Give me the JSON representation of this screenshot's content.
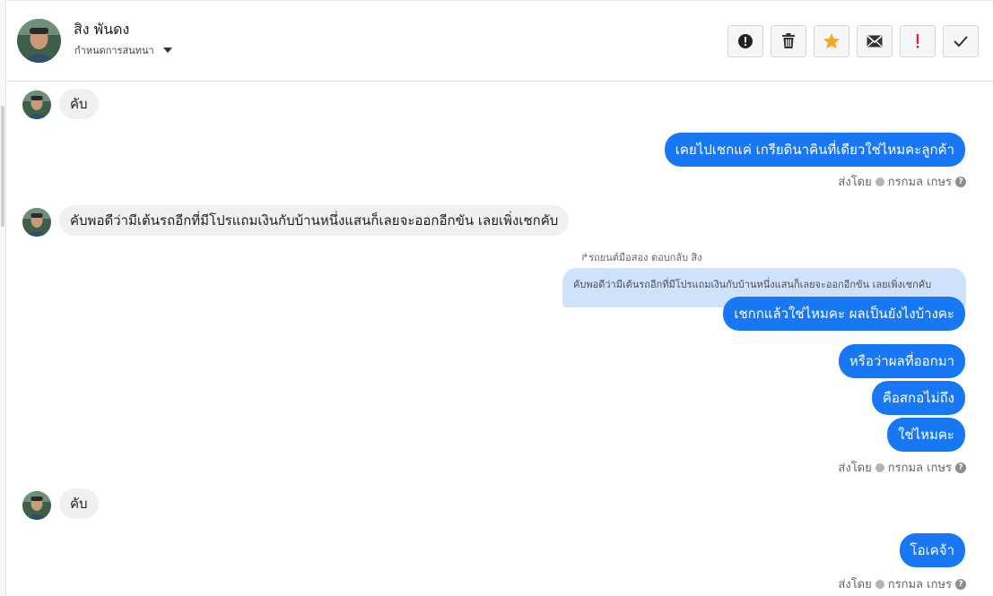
{
  "header": {
    "contact_name": "สิง พันดง",
    "assign_label": "กำหนดการสนทนา"
  },
  "actions": [
    {
      "name": "report-spam",
      "icon": "alert-circle-icon"
    },
    {
      "name": "delete",
      "icon": "trash-icon"
    },
    {
      "name": "star",
      "icon": "star-icon",
      "color": "#f5a623"
    },
    {
      "name": "mark-unread",
      "icon": "envelope-icon"
    },
    {
      "name": "follow-up",
      "icon": "exclamation-icon",
      "color": "#e41e3f"
    },
    {
      "name": "mark-done",
      "icon": "check-icon"
    }
  ],
  "colors": {
    "outgoing_bubble": "#1877f2",
    "incoming_bubble": "#f0f0f0",
    "quoted_bubble": "#cfe2fb"
  },
  "messages": {
    "in1": "คับ",
    "out1": "เคยไปเชกแค่ เกรียดินาคินที่เดียวใช่ไหมคะลูกค้า",
    "sent1": "ส่งโดย",
    "sender1": "กรกมล เกษร",
    "in2": "คับพอดีว่ามีเต้นรถอีกที่มีโปรแถมเงินกับบ้านหนึ่งแสนก็เลยจะออกอีกขัน เลยเพิ่งเชกคับ",
    "reply_note": "รถยนต์มือสอง ตอบกลับ สิง",
    "quoted": "คับพอดีว่ามีเต้นรถอีกที่มีโปรแถมเงินกับบ้านหนึ่งแสนก็เลยจะออกอีกขัน เลยเพิ่งเชกคับ",
    "out2": "เชกกแล้วใช่ไหมคะ ผลเป็นยังไงบ้างคะ",
    "out3": "หรือว่าผลที่ออกมา",
    "out4": "คือสกอไม่ถึง",
    "out5": "ใช่ไหมคะ",
    "sent2": "ส่งโดย",
    "sender2": "กรกมล เกษร",
    "in3": "คับ",
    "out6": "โอเคจ้า",
    "sent3": "ส่งโดย",
    "sender3": "กรกมล เกษร"
  }
}
